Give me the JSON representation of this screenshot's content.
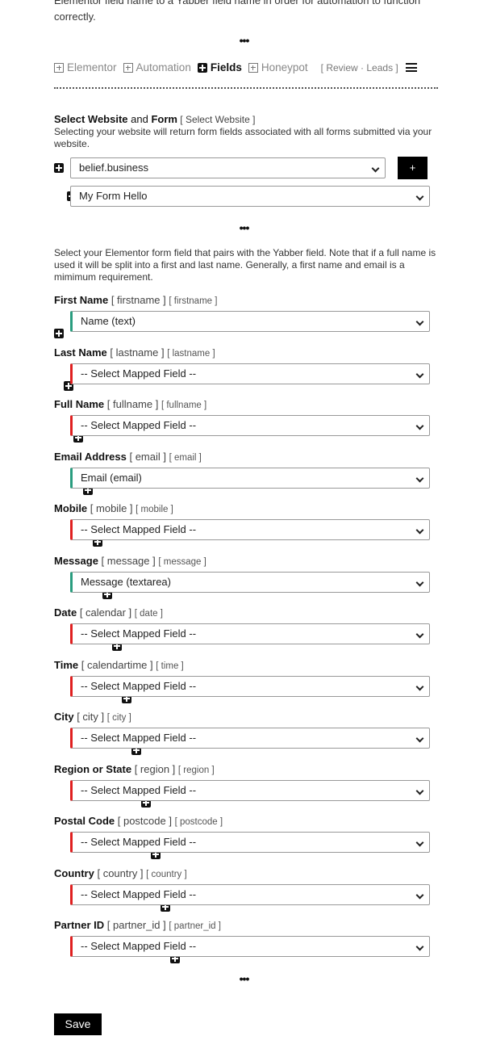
{
  "intro": {
    "line1": "Elementor field name to a Yabber field name in order for automation to function",
    "line2": "correctly."
  },
  "ellipsis": "•••",
  "tabs": [
    {
      "label": "Elementor",
      "active": false
    },
    {
      "label": "Automation",
      "active": false
    },
    {
      "label": "Fields",
      "active": true
    },
    {
      "label": "Honeypot",
      "active": false
    }
  ],
  "tab_links": {
    "open": "[",
    "review": "Review",
    "sep": "·",
    "leads": "Leads",
    "close": "]"
  },
  "website": {
    "heading_bold1": "Select Website",
    "heading_and": " and ",
    "heading_bold2": "Form",
    "heading_key": " [ Select Website ]",
    "description": "Selecting your website will return form fields associated with all forms submitted via your website.",
    "website_value": "belief.business",
    "add_button": "+",
    "form_value": "My Form Hello"
  },
  "fields_intro": "Select your Elementor form field that pairs with the Yabber field. Note that if a full name is used it will be split into a first and last name. Generally, a first name and email is a mimimum requirement.",
  "colors": {
    "mapped": "#2a9d7f",
    "unmapped": "#e02020"
  },
  "fields": [
    {
      "label": "First Name",
      "key1": "[ firstname ]",
      "key2": "[ firstname ]",
      "value": "Name (text)",
      "mapped": true
    },
    {
      "label": "Last Name",
      "key1": "[ lastname ]",
      "key2": "[ lastname ]",
      "value": "-- Select Mapped Field --",
      "mapped": false
    },
    {
      "label": "Full Name",
      "key1": "[ fullname ]",
      "key2": "[ fullname ]",
      "value": "-- Select Mapped Field --",
      "mapped": false
    },
    {
      "label": "Email Address",
      "key1": "[ email ]",
      "key2": "[ email ]",
      "value": "Email (email)",
      "mapped": true
    },
    {
      "label": "Mobile",
      "key1": "[ mobile ]",
      "key2": "[ mobile ]",
      "value": "-- Select Mapped Field --",
      "mapped": false
    },
    {
      "label": "Message",
      "key1": "[ message ]",
      "key2": "[ message ]",
      "value": "Message (textarea)",
      "mapped": true
    },
    {
      "label": "Date",
      "key1": "[ calendar ]",
      "key2": "[ date ]",
      "value": "-- Select Mapped Field --",
      "mapped": false
    },
    {
      "label": "Time",
      "key1": "[ calendartime ]",
      "key2": "[ time ]",
      "value": "-- Select Mapped Field --",
      "mapped": false
    },
    {
      "label": "City",
      "key1": "[ city ]",
      "key2": "[ city ]",
      "value": "-- Select Mapped Field --",
      "mapped": false
    },
    {
      "label": "Region or State",
      "key1": "[ region ]",
      "key2": "[ region ]",
      "value": "-- Select Mapped Field --",
      "mapped": false
    },
    {
      "label": "Postal Code",
      "key1": "[ postcode ]",
      "key2": "[ postcode ]",
      "value": "-- Select Mapped Field --",
      "mapped": false
    },
    {
      "label": "Country",
      "key1": "[ country ]",
      "key2": "[ country ]",
      "value": "-- Select Mapped Field --",
      "mapped": false
    },
    {
      "label": "Partner ID",
      "key1": "[ partner_id ]",
      "key2": "[ partner_id ]",
      "value": "-- Select Mapped Field --",
      "mapped": false
    }
  ],
  "save_label": "Save"
}
